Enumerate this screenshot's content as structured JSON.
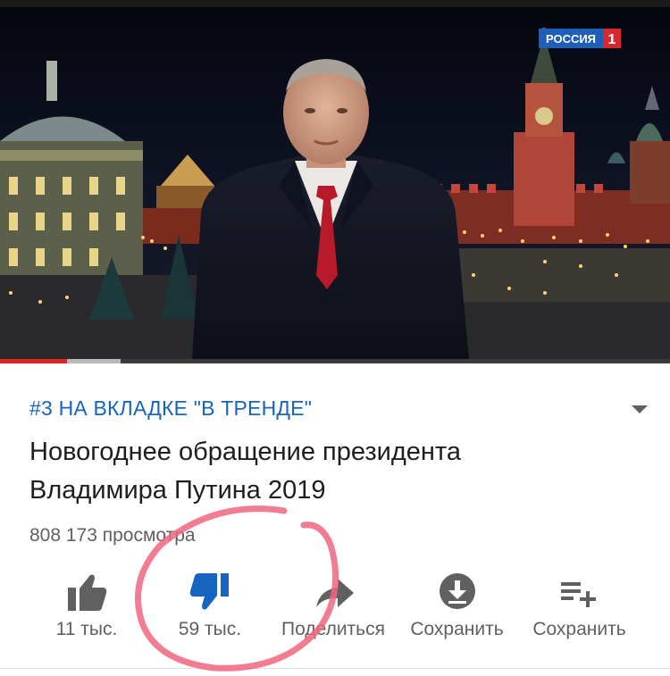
{
  "video": {
    "channel_logo_text": "РОССИЯ",
    "channel_logo_number": "1",
    "progress_fraction": 0.1,
    "buffered_fraction": 0.18
  },
  "info": {
    "trending_label": "#3 НА ВКЛАДКЕ \"В ТРЕНДЕ\"",
    "title": "Новогоднее обращение президента Владимира Путина 2019",
    "views": "808 173 просмотра"
  },
  "actions": {
    "like_count": "11 тыс.",
    "dislike_count": "59 тыс.",
    "share_label": "Поделиться",
    "download_label": "Сохранить",
    "save_label": "Сохранить"
  },
  "colors": {
    "accent_blue": "#1565c0",
    "progress_red": "#e0231d",
    "annotation_pink": "#f0667f",
    "icon_gray": "#606060"
  },
  "icons": {
    "like": "thumbs-up-icon",
    "dislike": "thumbs-down-icon",
    "share": "share-arrow-icon",
    "download": "download-icon",
    "save": "playlist-add-icon",
    "expand": "chevron-down-icon"
  }
}
